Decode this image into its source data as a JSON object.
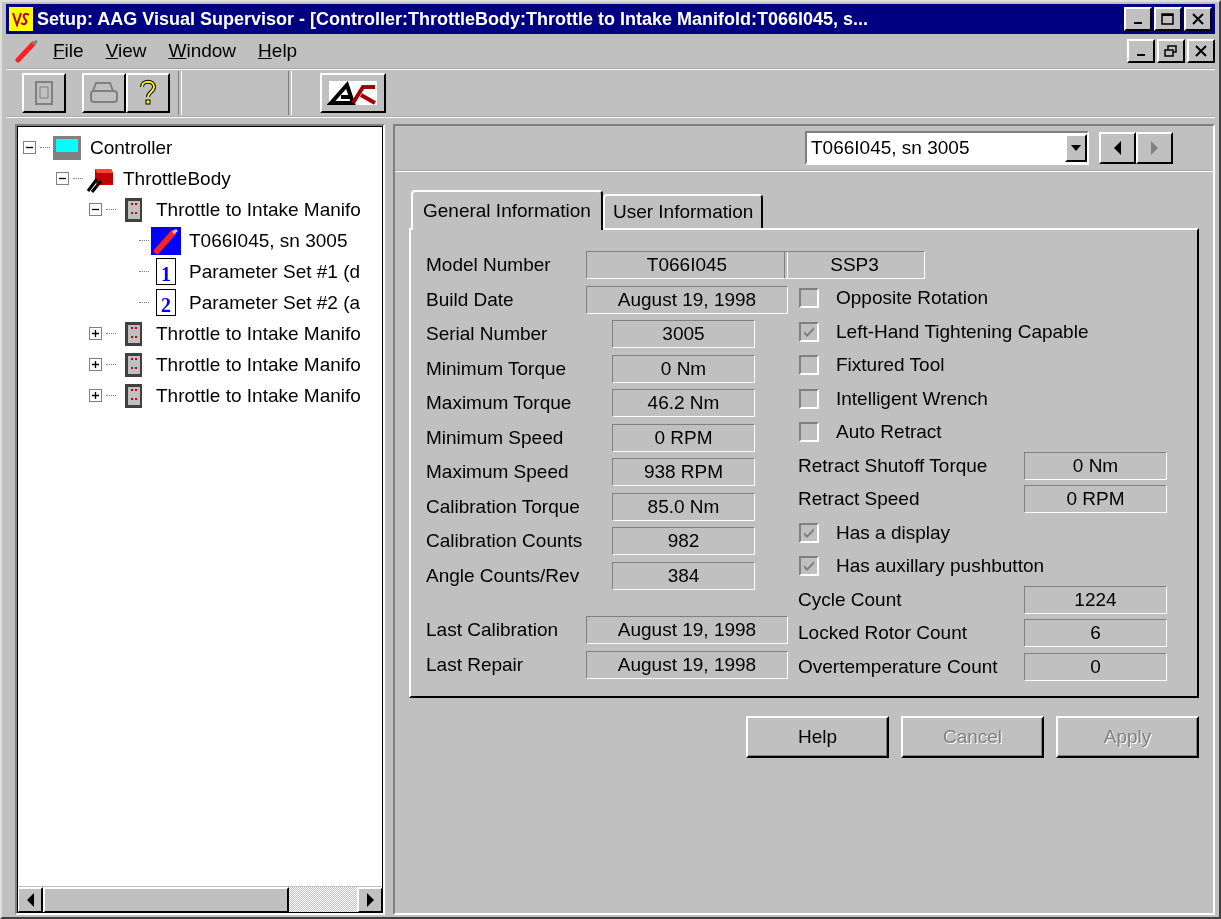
{
  "window": {
    "title": "Setup: AAG Visual Supervisor - [Controller:ThrottleBody:Throttle to Intake Manifold:T066I045, s..."
  },
  "menu": [
    "File",
    "View",
    "Window",
    "Help"
  ],
  "tree": [
    {
      "label": "Controller",
      "kind": "controller",
      "expanded": true,
      "selected": false,
      "children": [
        {
          "label": "ThrottleBody",
          "kind": "tool-body",
          "expanded": true,
          "selected": false,
          "children": [
            {
              "label": "Throttle to Intake Manifo",
              "kind": "station",
              "expanded": true,
              "selected": false,
              "children": [
                {
                  "label": "T066I045, sn 3005",
                  "kind": "tool",
                  "selected": true
                },
                {
                  "label": "Parameter Set #1 (d",
                  "kind": "param",
                  "badge": "1",
                  "selected": false
                },
                {
                  "label": "Parameter Set #2 (a",
                  "kind": "param",
                  "badge": "2",
                  "selected": false
                }
              ]
            },
            {
              "label": "Throttle to Intake Manifo",
              "kind": "station",
              "expanded": false,
              "selected": false
            },
            {
              "label": "Throttle to Intake Manifo",
              "kind": "station",
              "expanded": false,
              "selected": false
            },
            {
              "label": "Throttle to Intake Manifo",
              "kind": "station",
              "expanded": false,
              "selected": false
            }
          ]
        }
      ]
    }
  ],
  "selector": {
    "value": "T066I045, sn 3005",
    "prev_disabled": false,
    "next_disabled": true
  },
  "tabs": [
    {
      "label": "General Information",
      "selected": true
    },
    {
      "label": "User Information",
      "selected": false
    }
  ],
  "specs": [
    {
      "label": "Model Number",
      "value": "T066I045",
      "kind": "wide"
    },
    {
      "label": "Build Date",
      "value": "August 19, 1998",
      "kind": "wide"
    },
    {
      "label": "Serial Number",
      "value": "3005",
      "kind": "narrow"
    },
    {
      "label": "Minimum Torque",
      "value": "0 Nm",
      "kind": "narrow"
    },
    {
      "label": "Maximum Torque",
      "value": "46.2 Nm",
      "kind": "narrow"
    },
    {
      "label": "Minimum Speed",
      "value": "0 RPM",
      "kind": "narrow"
    },
    {
      "label": "Maximum Speed",
      "value": "938 RPM",
      "kind": "narrow"
    },
    {
      "label": "Calibration Torque",
      "value": "85.0 Nm",
      "kind": "narrow"
    },
    {
      "label": "Calibration Counts",
      "value": "982",
      "kind": "narrow"
    },
    {
      "label": "Angle Counts/Rev",
      "value": "384",
      "kind": "narrow"
    }
  ],
  "history": [
    {
      "label": "Last Calibration",
      "value": "August 19, 1998",
      "kind": "wide"
    },
    {
      "label": "Last Repair",
      "value": "August 19, 1998",
      "kind": "wide"
    }
  ],
  "options": [
    {
      "kind": "field",
      "value": "SSP3"
    },
    {
      "kind": "checkbox",
      "label": "Opposite Rotation",
      "checked": false
    },
    {
      "kind": "checkbox",
      "label": "Left-Hand Tightening Capable",
      "checked": true
    },
    {
      "kind": "checkbox",
      "label": "Fixtured Tool",
      "checked": false
    },
    {
      "kind": "checkbox",
      "label": "Intelligent Wrench",
      "checked": false
    },
    {
      "kind": "checkbox",
      "label": "Auto Retract",
      "checked": false
    },
    {
      "kind": "labeled",
      "label": "Retract Shutoff Torque",
      "value": "0 Nm"
    },
    {
      "kind": "labeled",
      "label": "Retract Speed",
      "value": "0 RPM"
    },
    {
      "kind": "checkbox",
      "label": "Has a display",
      "checked": true
    },
    {
      "kind": "checkbox",
      "label": "Has auxillary pushbutton",
      "checked": true
    },
    {
      "kind": "labeled",
      "label": "Cycle Count",
      "value": "1224"
    },
    {
      "kind": "labeled",
      "label": "Locked Rotor Count",
      "value": "6"
    },
    {
      "kind": "labeled",
      "label": "Overtemperature Count",
      "value": "0"
    }
  ],
  "buttons": [
    {
      "label": "Help",
      "disabled": false
    },
    {
      "label": "Cancel",
      "disabled": true
    },
    {
      "label": "Apply",
      "disabled": true
    }
  ]
}
